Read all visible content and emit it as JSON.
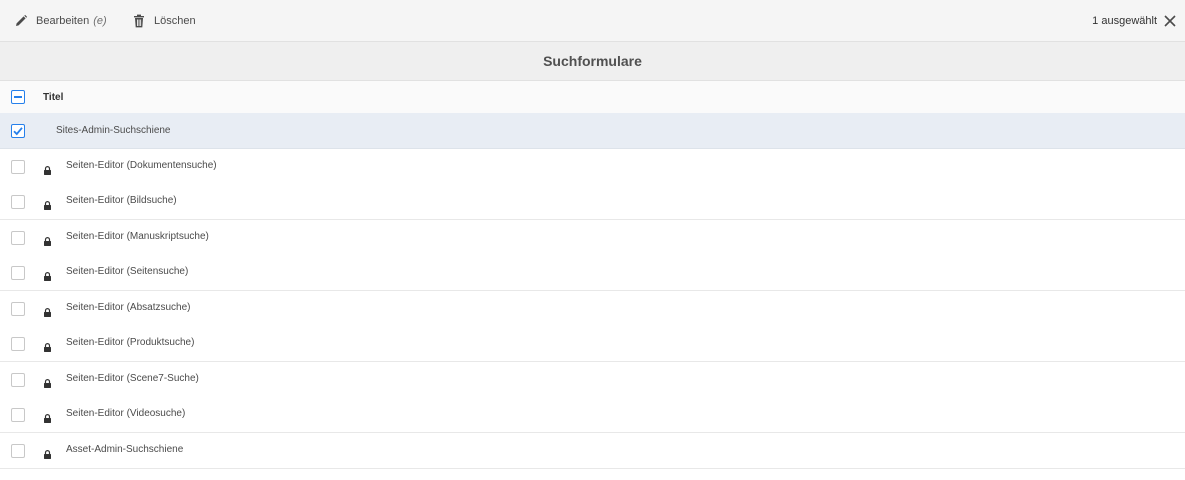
{
  "toolbar": {
    "edit_label": "Bearbeiten",
    "edit_shortcut": "(e)",
    "delete_label": "Löschen",
    "selection_count": "1 ausgewählt"
  },
  "page": {
    "title": "Suchformulare"
  },
  "table": {
    "column_title": "Titel",
    "rows": [
      {
        "label": "Sites-Admin-Suchschiene",
        "selected": true,
        "locked": false
      },
      {
        "label": "Seiten-Editor (Dokumentensuche)",
        "selected": false,
        "locked": true
      },
      {
        "label": "Seiten-Editor (Bildsuche)",
        "selected": false,
        "locked": true
      },
      {
        "label": "Seiten-Editor (Manuskriptsuche)",
        "selected": false,
        "locked": true
      },
      {
        "label": "Seiten-Editor (Seitensuche)",
        "selected": false,
        "locked": true
      },
      {
        "label": "Seiten-Editor (Absatzsuche)",
        "selected": false,
        "locked": true
      },
      {
        "label": "Seiten-Editor (Produktsuche)",
        "selected": false,
        "locked": true
      },
      {
        "label": "Seiten-Editor (Scene7-Suche)",
        "selected": false,
        "locked": true
      },
      {
        "label": "Seiten-Editor (Videosuche)",
        "selected": false,
        "locked": true
      },
      {
        "label": "Asset-Admin-Suchschiene",
        "selected": false,
        "locked": true
      }
    ]
  },
  "colors": {
    "accent": "#2680eb",
    "selected_row": "#e8edf4"
  }
}
